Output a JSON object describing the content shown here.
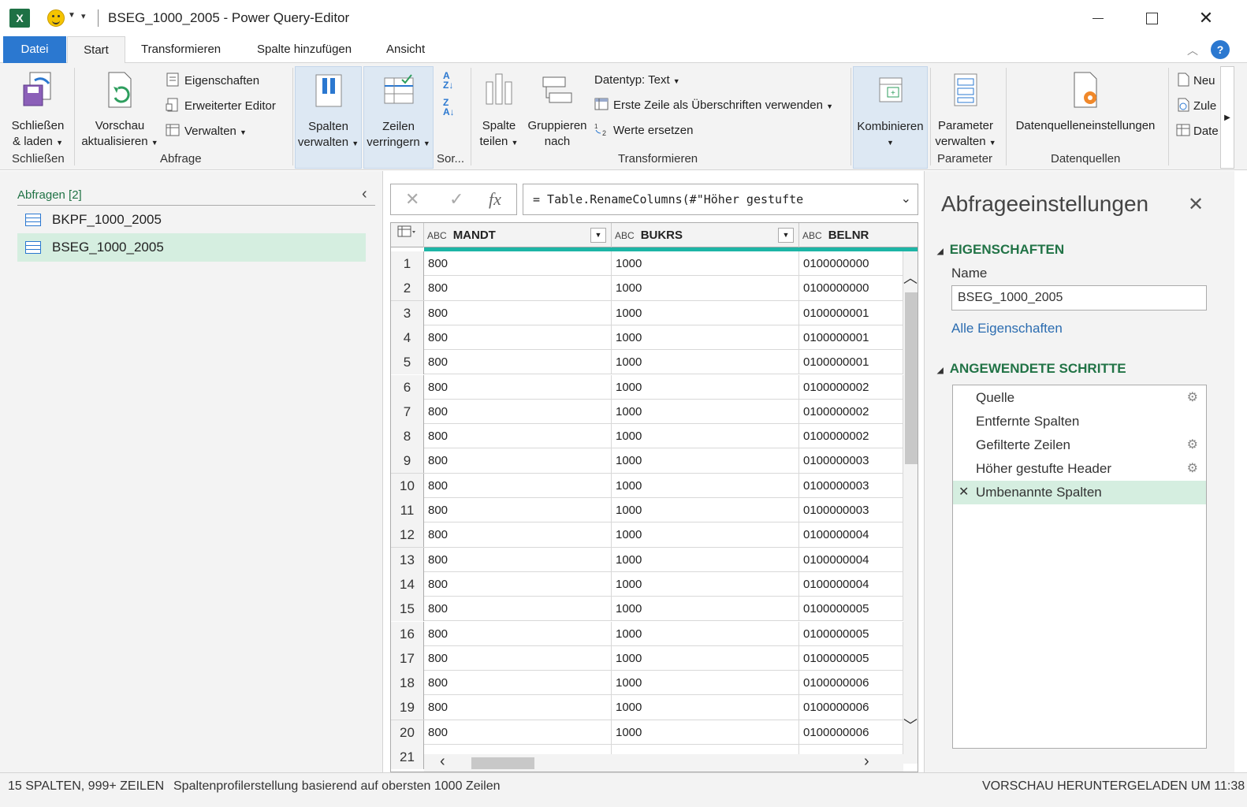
{
  "window": {
    "title": "BSEG_1000_2005 - Power Query-Editor",
    "app_icon": "X",
    "controls": {
      "close": "✕"
    }
  },
  "tabs": [
    "Datei",
    "Start",
    "Transformieren",
    "Spalte hinzufügen",
    "Ansicht"
  ],
  "help": "?",
  "ribbon": {
    "schliessen": {
      "btn_line1": "Schließen",
      "btn_line2": "& laden",
      "group": "Schließen"
    },
    "abfrage": {
      "vorschau_line1": "Vorschau",
      "vorschau_line2": "aktualisieren",
      "eigenschaften": "Eigenschaften",
      "erweiterter_editor": "Erweiterter Editor",
      "verwalten": "Verwalten",
      "group": "Abfrage"
    },
    "spalten": {
      "line1": "Spalten",
      "line2": "verwalten"
    },
    "zeilen": {
      "line1": "Zeilen",
      "line2": "verringern"
    },
    "sort": {
      "group": "Sor..."
    },
    "transformieren": {
      "spalte_line1": "Spalte",
      "spalte_line2": "teilen",
      "gruppieren_line1": "Gruppieren",
      "gruppieren_line2": "nach",
      "datentyp": "Datentyp: Text",
      "erste_zeile": "Erste Zeile als Überschriften verwenden",
      "werte_ersetzen": "Werte ersetzen",
      "group": "Transformieren"
    },
    "kombinieren": {
      "label": "Kombinieren"
    },
    "parameter": {
      "line1": "Parameter",
      "line2": "verwalten",
      "group": "Parameter"
    },
    "datenquellen": {
      "label": "Datenquelleneinstellungen",
      "group": "Datenquellen"
    },
    "neue_abfrage": {
      "neu": "Neu",
      "zule": "Zule",
      "date": "Date"
    }
  },
  "queries": {
    "header": "Abfragen [2]",
    "items": [
      "BKPF_1000_2005",
      "BSEG_1000_2005"
    ],
    "selected_index": 1
  },
  "formula_bar": {
    "cancel": "✕",
    "confirm": "✓",
    "fx": "fx",
    "formula": "= Table.RenameColumns(#\"Höher gestufte"
  },
  "grid": {
    "type_prefix": "ABC",
    "columns": [
      "MANDT",
      "BUKRS",
      "BELNR"
    ],
    "rows": [
      [
        "1",
        "800",
        "1000",
        "0100000000"
      ],
      [
        "2",
        "800",
        "1000",
        "0100000000"
      ],
      [
        "3",
        "800",
        "1000",
        "0100000001"
      ],
      [
        "4",
        "800",
        "1000",
        "0100000001"
      ],
      [
        "5",
        "800",
        "1000",
        "0100000001"
      ],
      [
        "6",
        "800",
        "1000",
        "0100000002"
      ],
      [
        "7",
        "800",
        "1000",
        "0100000002"
      ],
      [
        "8",
        "800",
        "1000",
        "0100000002"
      ],
      [
        "9",
        "800",
        "1000",
        "0100000003"
      ],
      [
        "10",
        "800",
        "1000",
        "0100000003"
      ],
      [
        "11",
        "800",
        "1000",
        "0100000003"
      ],
      [
        "12",
        "800",
        "1000",
        "0100000004"
      ],
      [
        "13",
        "800",
        "1000",
        "0100000004"
      ],
      [
        "14",
        "800",
        "1000",
        "0100000004"
      ],
      [
        "15",
        "800",
        "1000",
        "0100000005"
      ],
      [
        "16",
        "800",
        "1000",
        "0100000005"
      ],
      [
        "17",
        "800",
        "1000",
        "0100000005"
      ],
      [
        "18",
        "800",
        "1000",
        "0100000006"
      ],
      [
        "19",
        "800",
        "1000",
        "0100000006"
      ],
      [
        "20",
        "800",
        "1000",
        "0100000006"
      ],
      [
        "21",
        "",
        "",
        ""
      ]
    ]
  },
  "settings": {
    "title": "Abfrageeinstellungen",
    "eigenschaften_header": "EIGENSCHAFTEN",
    "name_label": "Name",
    "name_value": "BSEG_1000_2005",
    "alle_eigenschaften": "Alle Eigenschaften",
    "steps_header": "ANGEWENDETE SCHRITTE",
    "steps": [
      {
        "label": "Quelle",
        "gear": true
      },
      {
        "label": "Entfernte Spalten",
        "gear": false
      },
      {
        "label": "Gefilterte Zeilen",
        "gear": true
      },
      {
        "label": "Höher gestufte Header",
        "gear": true
      },
      {
        "label": "Umbenannte Spalten",
        "gear": false
      }
    ],
    "selected_step": 4
  },
  "status": {
    "left": "15 SPALTEN, 999+ ZEILEN",
    "middle": "Spaltenprofilerstellung basierend auf obersten 1000 Zeilen",
    "right": "VORSCHAU HERUNTERGELADEN UM 11:38"
  },
  "colors": {
    "accent_blue": "#2b78d0",
    "excel_green": "#217346",
    "selection_green": "#d5eee0",
    "teal_quality_bar": "#1db5a6"
  }
}
